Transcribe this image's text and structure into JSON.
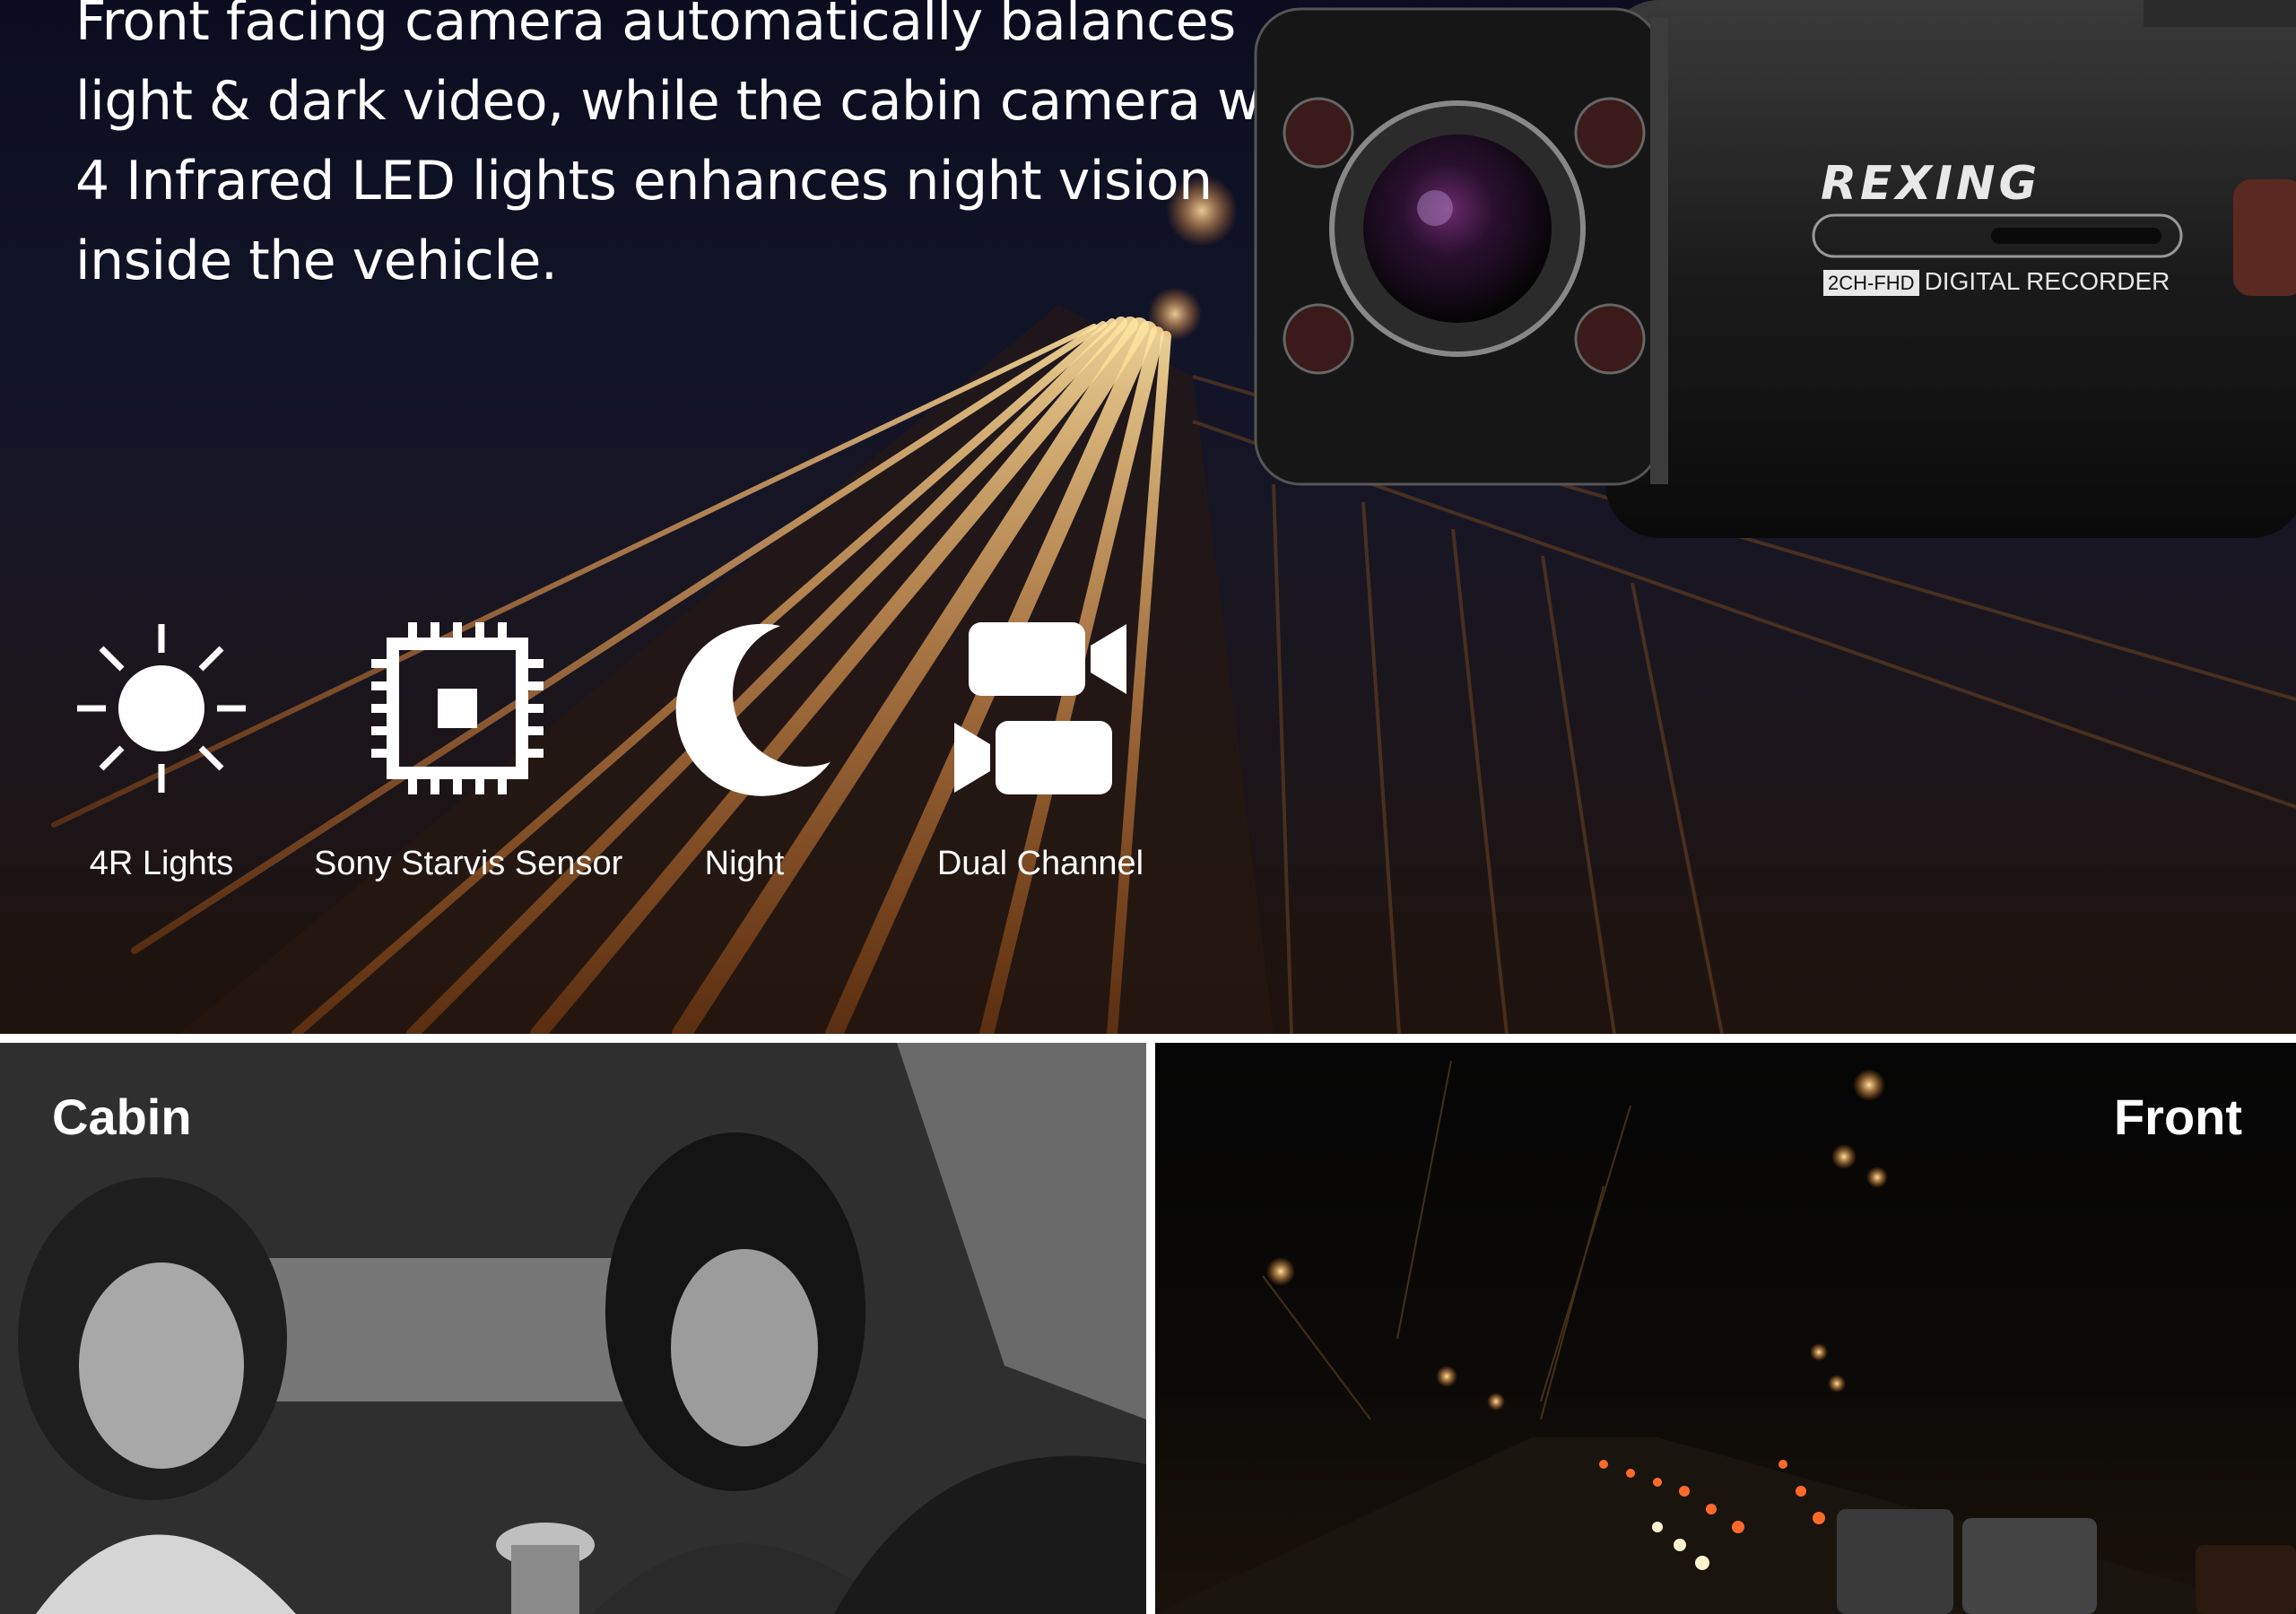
{
  "hero": {
    "headline_lines": [
      "Front facing camera automatically balances",
      "light & dark video, while the cabin camera with",
      "4 Infrared LED lights enhances night vision",
      "inside the vehicle."
    ],
    "camera_brand": "REXING",
    "camera_model_tag": "2CH-FHD",
    "camera_model_text": "DIGITAL RECORDER"
  },
  "features": [
    {
      "icon": "sun-icon",
      "label": "4R Lights"
    },
    {
      "icon": "chip-icon",
      "label": "Sony Starvis Sensor"
    },
    {
      "icon": "moon-icon",
      "label": "Night"
    },
    {
      "icon": "dual-camera-icon",
      "label": "Dual Channel"
    }
  ],
  "panels": {
    "cabin_title": "Cabin",
    "front_title": "Front"
  },
  "colors": {
    "accent_orange": "#ff9a3c",
    "text": "#ffffff"
  }
}
